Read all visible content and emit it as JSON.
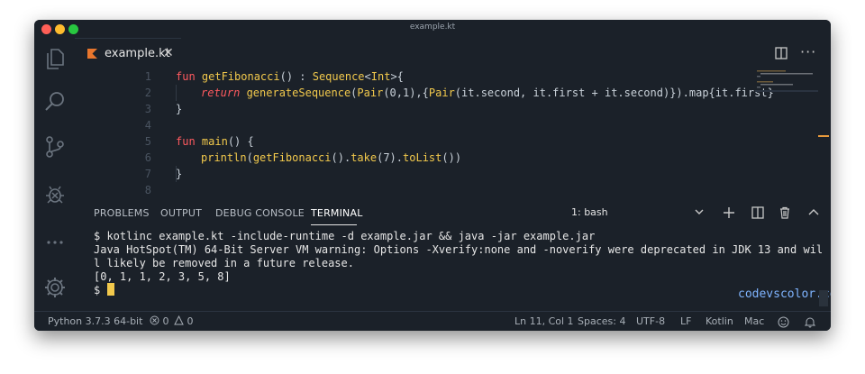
{
  "window": {
    "title": "example.kt"
  },
  "tab": {
    "label": "example.kt"
  },
  "editor": {
    "lines": [
      {
        "num": "1",
        "tokens": [
          [
            "kw",
            "fun "
          ],
          [
            "fn",
            "getFibonacci"
          ],
          [
            "pn",
            "() : "
          ],
          [
            "fn",
            "Sequence"
          ],
          [
            "pn",
            "<"
          ],
          [
            "fn",
            "Int"
          ],
          [
            "pn",
            ">{"
          ]
        ]
      },
      {
        "num": "2",
        "tokens": [
          [
            "ret",
            "return "
          ],
          [
            "fn",
            "generateSequence"
          ],
          [
            "pn",
            "("
          ],
          [
            "fn",
            "Pair"
          ],
          [
            "pn",
            "(0,1),{"
          ],
          [
            "fn",
            "Pair"
          ],
          [
            "pn",
            "(it.second, it.first + it.second)}).map{it.first}"
          ]
        ]
      },
      {
        "num": "3",
        "tokens": [
          [
            "pn",
            "}"
          ]
        ]
      },
      {
        "num": "4",
        "tokens": []
      },
      {
        "num": "5",
        "tokens": [
          [
            "kw",
            "fun "
          ],
          [
            "fn",
            "main"
          ],
          [
            "pn",
            "() {"
          ]
        ]
      },
      {
        "num": "6",
        "tokens": [
          [
            "fn",
            "println"
          ],
          [
            "pn",
            "("
          ],
          [
            "fn",
            "getFibonacci"
          ],
          [
            "pn",
            "()."
          ],
          [
            "fn",
            "take"
          ],
          [
            "pn",
            "(7)."
          ],
          [
            "fn",
            "toList"
          ],
          [
            "pn",
            "())"
          ]
        ]
      },
      {
        "num": "7",
        "tokens": [
          [
            "pn",
            "}"
          ]
        ]
      },
      {
        "num": "8",
        "tokens": []
      }
    ]
  },
  "panel": {
    "tabs": [
      "PROBLEMS",
      "OUTPUT",
      "DEBUG CONSOLE",
      "TERMINAL"
    ],
    "active_tab": "TERMINAL",
    "terminal_select": "1: bash"
  },
  "terminal": {
    "lines": [
      "$ kotlinc example.kt -include-runtime -d example.jar && java -jar example.jar",
      "Java HotSpot(TM) 64-Bit Server VM warning: Options -Xverify:none and -noverify were deprecated in JDK 13 and wil",
      "l likely be removed in a future release.",
      "[0, 1, 1, 2, 3, 5, 8]",
      "$ "
    ],
    "watermark": "codevscolor.com"
  },
  "status": {
    "python": "Python 3.7.3 64-bit",
    "errors": "0",
    "warnings": "0",
    "position": "Ln 11, Col 1",
    "spaces": "Spaces: 4",
    "encoding": "UTF-8",
    "eol": "LF",
    "language": "Kotlin",
    "platform": "Mac"
  },
  "colors": {
    "background": "#1b2129",
    "keyword": "#ff5a5f",
    "function": "#f2c94c",
    "text": "#c9d1d9",
    "line_number": "#4a5461",
    "cursor": "#f2c94c",
    "watermark": "#7fb4ff",
    "kotlin_logo": "#e8762d"
  }
}
